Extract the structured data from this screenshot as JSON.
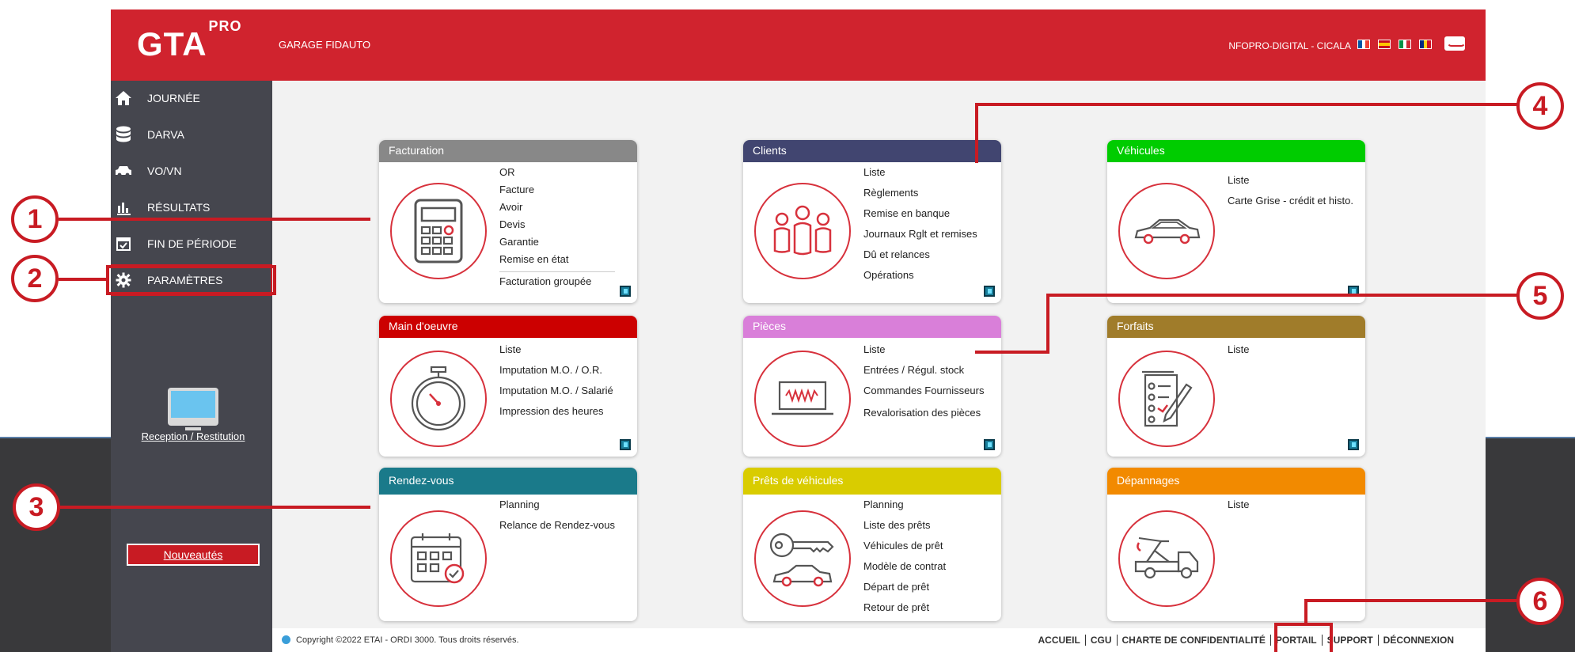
{
  "header": {
    "logo": "GTA",
    "logo_sup": "PRO",
    "garage": "GARAGE FIDAUTO",
    "user": "NFOPRO-DIGITAL - CICALA"
  },
  "sidebar": {
    "items": [
      {
        "label": "JOURNÉE",
        "icon": "home-icon"
      },
      {
        "label": "DARVA",
        "icon": "database-icon"
      },
      {
        "label": "VO/VN",
        "icon": "car-icon"
      },
      {
        "label": "RÉSULTATS",
        "icon": "bar-chart-icon"
      },
      {
        "label": "FIN DE PÉRIODE",
        "icon": "calendar-check-icon"
      },
      {
        "label": "PARAMÈTRES",
        "icon": "gear-icon"
      }
    ],
    "reception": "Reception / Restitution",
    "news": "Nouveautés"
  },
  "cards": {
    "facturation": {
      "title": "Facturation",
      "color": "#888888",
      "links": [
        "OR",
        "Facture",
        "Avoir",
        "Devis",
        "Garantie",
        "Remise en état",
        "Facturation groupée"
      ]
    },
    "clients": {
      "title": "Clients",
      "color": "#414570",
      "links": [
        "Liste",
        "Règlements",
        "Remise en banque",
        "Journaux Rglt et remises",
        "Dû et relances",
        "Opérations"
      ]
    },
    "vehicules": {
      "title": "Véhicules",
      "color": "#00cc00",
      "links": [
        "Liste",
        "Carte Grise - crédit et histo."
      ]
    },
    "main_oeuvre": {
      "title": "Main d'oeuvre",
      "color": "#cc0000",
      "links": [
        "Liste",
        "Imputation M.O. / O.R.",
        "Imputation M.O. / Salarié",
        "Impression des heures"
      ]
    },
    "pieces": {
      "title": "Pièces",
      "color": "#d97fd9",
      "links": [
        "Liste",
        "Entrées / Régul. stock",
        "Commandes Fournisseurs",
        "Revalorisation des pièces"
      ]
    },
    "forfaits": {
      "title": "Forfaits",
      "color": "#a07c2a",
      "links": [
        "Liste"
      ]
    },
    "rendez_vous": {
      "title": "Rendez-vous",
      "color": "#1a7a8a",
      "links": [
        "Planning",
        "Relance de Rendez-vous"
      ]
    },
    "prets": {
      "title": "Prêts de véhicules",
      "color": "#d9cc00",
      "links": [
        "Planning",
        "Liste des prêts",
        "Véhicules de prêt",
        "Modèle de contrat",
        "Départ de prêt",
        "Retour de prêt"
      ]
    },
    "depannages": {
      "title": "Dépannages",
      "color": "#f28a00",
      "links": [
        "Liste"
      ]
    }
  },
  "footer": {
    "copyright": "Copyright ©2022 ETAI - ORDI 3000. Tous droits réservés.",
    "links": [
      "ACCUEIL",
      "CGU",
      "CHARTE DE CONFIDENTIALITÉ",
      "PORTAIL",
      "SUPPORT",
      "DÉCONNEXION"
    ]
  },
  "callouts": [
    "1",
    "2",
    "3",
    "4",
    "5",
    "6"
  ],
  "colors": {
    "brand_red": "#d0232e",
    "sidebar": "#45464e",
    "callout": "#c81b23"
  }
}
